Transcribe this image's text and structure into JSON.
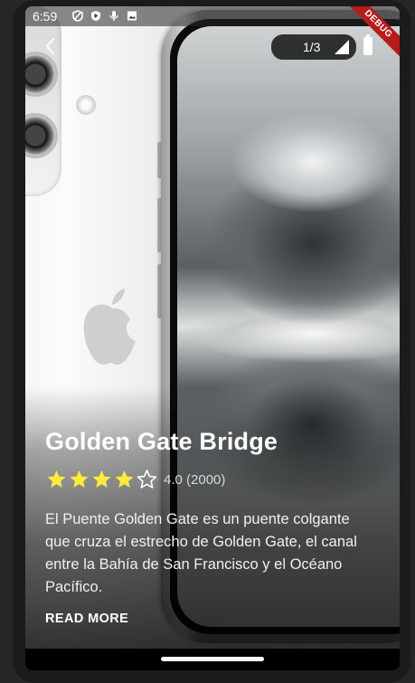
{
  "status_bar": {
    "time": "6:59"
  },
  "debug_banner": "DEBUG",
  "page_indicator": "1/3",
  "place": {
    "title": "Golden Gate Bridge",
    "rating": 4,
    "rating_max": 5,
    "rating_text": "4.0 (2000)",
    "description": "El Puente Golden Gate es un puente colgante que cruza el estrecho de Golden Gate, el canal entre la Bahía de San Francisco y el Océano Pacífico.",
    "read_more_label": "READ MORE"
  },
  "colors": {
    "star_filled": "#FFEB3B",
    "star_empty": "#FFFFFF",
    "debug_banner": "#B71C1C"
  },
  "icons": {
    "back": "arrow-back-icon",
    "signal": "signal-icon",
    "battery": "battery-icon"
  }
}
